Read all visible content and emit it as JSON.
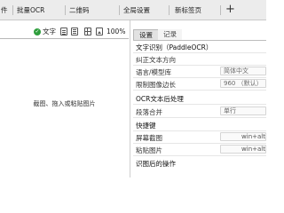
{
  "tabs": [
    {
      "label": "件"
    },
    {
      "label": "批量OCR"
    },
    {
      "label": "二维码"
    },
    {
      "label": "全局设置"
    },
    {
      "label": "新标签页"
    }
  ],
  "add_tab": "+",
  "left_toolbar": {
    "text_label": "文字",
    "zoom": "100%"
  },
  "drop_hint": "截图、拖入或粘贴图片",
  "right_tabs": {
    "settings": "设置",
    "records": "记录"
  },
  "settings": {
    "ocr_section": "文字识别（PaddleOCR）",
    "correct_direction": "纠正文本方向",
    "language_label": "语言/模型库",
    "language_value": "简体中文",
    "limit_label": "限制图像边长",
    "limit_value": "960 （默认）",
    "post_section": "OCR文本后处理",
    "paragraph_label": "段落合并",
    "paragraph_value": "单行",
    "hotkey_section": "快捷键",
    "screenshot_label": "屏幕截图",
    "screenshot_value": "win+alt",
    "paste_label": "粘贴图片",
    "paste_value": "win+alt",
    "after_section": "识图后的操作"
  }
}
